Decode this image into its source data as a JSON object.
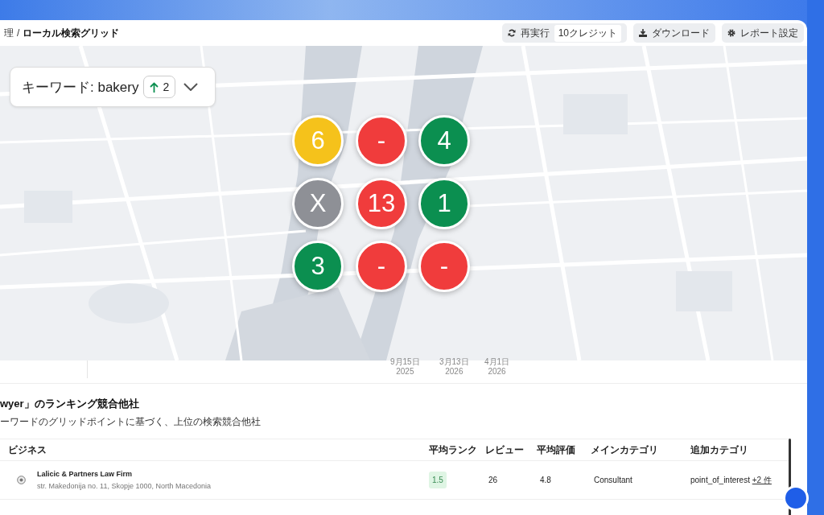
{
  "breadcrumb": {
    "parent": "理",
    "separator": "/",
    "current": "ローカル検索グリッド"
  },
  "toolbar": {
    "rerun": {
      "label": "再実行",
      "credits": "10クレジット"
    },
    "download": "ダウンロード",
    "settings": "レポート設定"
  },
  "map": {
    "keyword": {
      "label": "キーワード: bakery",
      "change": "2"
    },
    "grid": [
      [
        {
          "value": "6",
          "color": "#f5c21b"
        },
        {
          "value": "-",
          "color": "#f03c3c"
        },
        {
          "value": "4",
          "color": "#0b8f50"
        }
      ],
      [
        {
          "value": "X",
          "color": "#8e9096"
        },
        {
          "value": "13",
          "color": "#f03c3c"
        },
        {
          "value": "1",
          "color": "#0b8f50"
        }
      ],
      [
        {
          "value": "3",
          "color": "#0b8f50"
        },
        {
          "value": "-",
          "color": "#f03c3c"
        },
        {
          "value": "-",
          "color": "#f03c3c"
        }
      ]
    ]
  },
  "timeline": [
    {
      "date": "9月15日",
      "year": "2025"
    },
    {
      "date": "3月13日",
      "year": "2026"
    },
    {
      "date": "4月1日",
      "year": "2026"
    }
  ],
  "competitors": {
    "title": "wyer」のランキング競合他社",
    "subtitle": "ーワードのグリッドポイントに基づく、上位の検索競合他社",
    "columns": [
      "ビジネス",
      "平均ランク",
      "レビュー",
      "平均評価",
      "メインカテゴリ",
      "追加カテゴリ"
    ],
    "rows": [
      {
        "name": "Lalicic & Partners Law Firm",
        "address": "str. Makedonija no. 11, Skopje 1000, North Macedonia",
        "rank": "1.5",
        "reviews": "26",
        "rating": "4.8",
        "main_category": "Consultant",
        "extra_category": "point_of_interest",
        "more": "+2 件"
      }
    ]
  }
}
